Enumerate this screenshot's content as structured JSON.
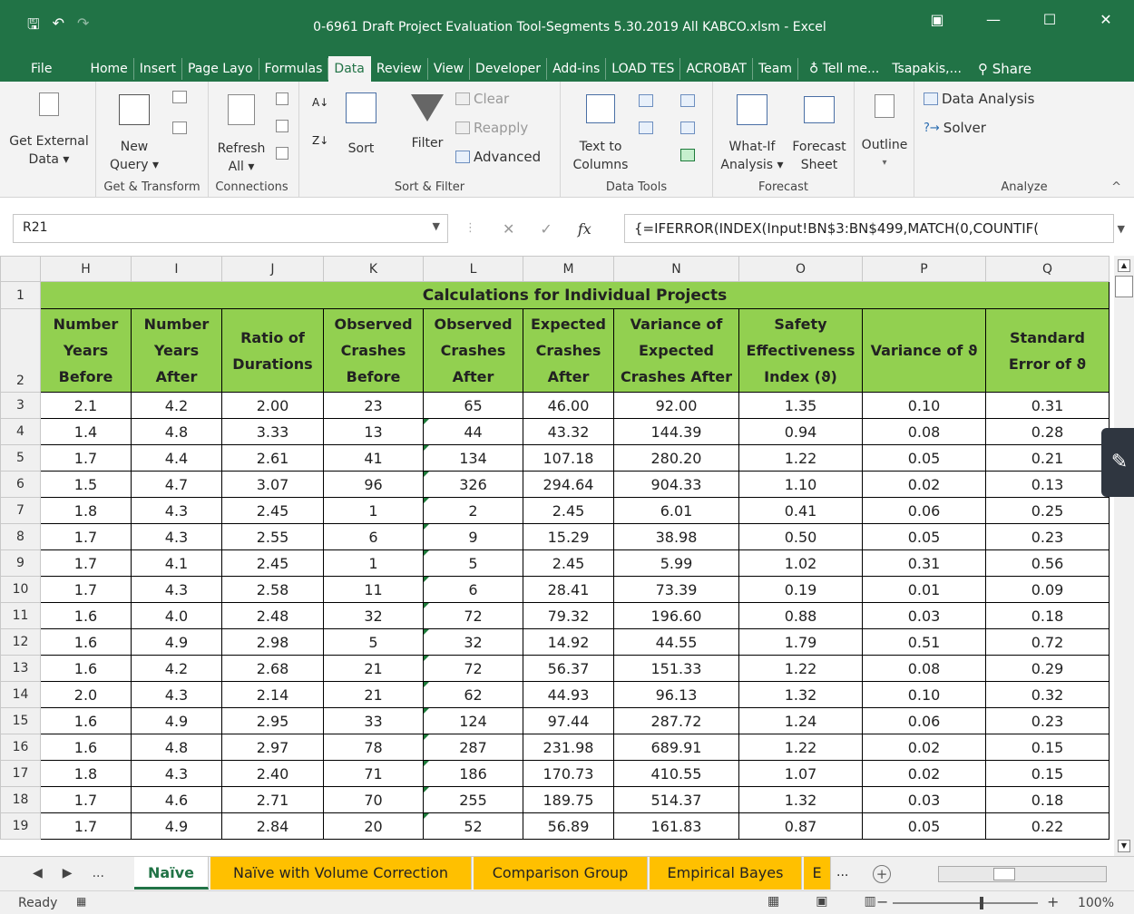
{
  "window": {
    "title": "0-6961 Draft Project Evaluation Tool-Segments 5.30.2019 All KABCO.xlsm - Excel",
    "min": "—",
    "max": "☐",
    "close": "✕",
    "restore": "▣"
  },
  "qat": {
    "save": "🖫",
    "undo": "↶",
    "redo": "↷"
  },
  "tabs": [
    "File",
    "Home",
    "Insert",
    "Page Layo",
    "Formulas",
    "Data",
    "Review",
    "View",
    "Developer",
    "Add-ins",
    "LOAD TES",
    "ACROBAT",
    "Team"
  ],
  "tell_me": "Tell me...",
  "user": "Tsapakis,...",
  "share": "Share",
  "ribbon": {
    "get_external": "Get External",
    "data_dd": "Data ▾",
    "new": "New",
    "query": "Query ▾",
    "group_get_transform": "Get & Transform",
    "refresh": "Refresh",
    "all": "All ▾",
    "group_connections": "Connections",
    "sort": "Sort",
    "filter": "Filter",
    "clear": "Clear",
    "reapply": "Reapply",
    "advanced": "Advanced",
    "group_sort_filter": "Sort & Filter",
    "text_to": "Text to",
    "columns": "Columns",
    "group_data_tools": "Data Tools",
    "whatif": "What-If",
    "analysis": "Analysis ▾",
    "forecast": "Forecast",
    "sheet": "Sheet",
    "group_forecast": "Forecast",
    "outline": "Outline",
    "outline_dd": "▾",
    "data_analysis": "Data Analysis",
    "solver": "Solver",
    "group_analyze": "Analyze",
    "collapse": "^"
  },
  "formula_bar": {
    "name_box": "R21",
    "cancel": "✕",
    "enter": "✓",
    "fx": "fx",
    "formula": "{=IFERROR(INDEX(Input!BN$3:BN$499,MATCH(0,COUNTIF("
  },
  "columns": [
    "H",
    "I",
    "J",
    "K",
    "L",
    "M",
    "N",
    "O",
    "P",
    "Q"
  ],
  "banner": "Calculations for Individual Projects",
  "headers": [
    "Number Years Before",
    "Number Years After",
    "Ratio of Durations",
    "Observed Crashes Before",
    "Observed Crashes After",
    "Expected Crashes After",
    "Variance of Expected Crashes After",
    "Safety Effectiveness Index (ϑ)",
    "Variance of ϑ",
    "Standard Error of ϑ"
  ],
  "rows": [
    {
      "n": "3",
      "v": [
        "2.1",
        "4.2",
        "2.00",
        "23",
        "65",
        "46.00",
        "92.00",
        "1.35",
        "0.10",
        "0.31"
      ]
    },
    {
      "n": "4",
      "v": [
        "1.4",
        "4.8",
        "3.33",
        "13",
        "44",
        "43.32",
        "144.39",
        "0.94",
        "0.08",
        "0.28"
      ]
    },
    {
      "n": "5",
      "v": [
        "1.7",
        "4.4",
        "2.61",
        "41",
        "134",
        "107.18",
        "280.20",
        "1.22",
        "0.05",
        "0.21"
      ]
    },
    {
      "n": "6",
      "v": [
        "1.5",
        "4.7",
        "3.07",
        "96",
        "326",
        "294.64",
        "904.33",
        "1.10",
        "0.02",
        "0.13"
      ]
    },
    {
      "n": "7",
      "v": [
        "1.8",
        "4.3",
        "2.45",
        "1",
        "2",
        "2.45",
        "6.01",
        "0.41",
        "0.06",
        "0.25"
      ]
    },
    {
      "n": "8",
      "v": [
        "1.7",
        "4.3",
        "2.55",
        "6",
        "9",
        "15.29",
        "38.98",
        "0.50",
        "0.05",
        "0.23"
      ]
    },
    {
      "n": "9",
      "v": [
        "1.7",
        "4.1",
        "2.45",
        "1",
        "5",
        "2.45",
        "5.99",
        "1.02",
        "0.31",
        "0.56"
      ]
    },
    {
      "n": "10",
      "v": [
        "1.7",
        "4.3",
        "2.58",
        "11",
        "6",
        "28.41",
        "73.39",
        "0.19",
        "0.01",
        "0.09"
      ]
    },
    {
      "n": "11",
      "v": [
        "1.6",
        "4.0",
        "2.48",
        "32",
        "72",
        "79.32",
        "196.60",
        "0.88",
        "0.03",
        "0.18"
      ]
    },
    {
      "n": "12",
      "v": [
        "1.6",
        "4.9",
        "2.98",
        "5",
        "32",
        "14.92",
        "44.55",
        "1.79",
        "0.51",
        "0.72"
      ]
    },
    {
      "n": "13",
      "v": [
        "1.6",
        "4.2",
        "2.68",
        "21",
        "72",
        "56.37",
        "151.33",
        "1.22",
        "0.08",
        "0.29"
      ]
    },
    {
      "n": "14",
      "v": [
        "2.0",
        "4.3",
        "2.14",
        "21",
        "62",
        "44.93",
        "96.13",
        "1.32",
        "0.10",
        "0.32"
      ]
    },
    {
      "n": "15",
      "v": [
        "1.6",
        "4.9",
        "2.95",
        "33",
        "124",
        "97.44",
        "287.72",
        "1.24",
        "0.06",
        "0.23"
      ]
    },
    {
      "n": "16",
      "v": [
        "1.6",
        "4.8",
        "2.97",
        "78",
        "287",
        "231.98",
        "689.91",
        "1.22",
        "0.02",
        "0.15"
      ]
    },
    {
      "n": "17",
      "v": [
        "1.8",
        "4.3",
        "2.40",
        "71",
        "186",
        "170.73",
        "410.55",
        "1.07",
        "0.02",
        "0.15"
      ]
    },
    {
      "n": "18",
      "v": [
        "1.7",
        "4.6",
        "2.71",
        "70",
        "255",
        "189.75",
        "514.37",
        "1.32",
        "0.03",
        "0.18"
      ]
    },
    {
      "n": "19",
      "v": [
        "1.7",
        "4.9",
        "2.84",
        "20",
        "52",
        "56.89",
        "161.83",
        "0.87",
        "0.05",
        "0.22"
      ]
    }
  ],
  "row_labels": {
    "banner": "1",
    "header": "2"
  },
  "sheets": [
    "Naïve",
    "Naïve with Volume Correction",
    "Comparison Group",
    "Empirical Bayes",
    "E"
  ],
  "sheet_more": "...",
  "status": {
    "ready": "Ready",
    "zoom": "100%",
    "minus": "−",
    "plus": "+"
  },
  "colors": {
    "excel_green": "#217346",
    "header_fill": "#92d050",
    "tab_gold": "#ffc000"
  }
}
